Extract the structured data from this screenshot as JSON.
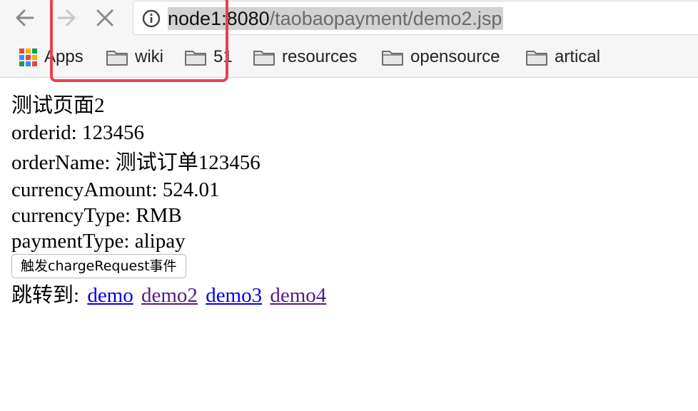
{
  "browser": {
    "url_host": "node1:8080",
    "url_path": "/taobaopayment/demo2.jsp",
    "bookmarks": {
      "apps": "Apps",
      "items": [
        "wiki",
        "51",
        "resources",
        "opensource",
        "artical"
      ]
    },
    "icons": [
      "back-arrow-icon",
      "forward-arrow-icon",
      "stop-icon",
      "info-icon",
      "apps-grid-icon",
      "folder-icon"
    ],
    "highlight_color": "#e8424f"
  },
  "page": {
    "title": "测试页面2",
    "orderid": "orderid: 123456",
    "orderName": "orderName: 测试订单123456",
    "currencyAmount": "currencyAmount: 524.01",
    "currencyType": "currencyType: RMB",
    "paymentType": "paymentType: alipay",
    "charge_button": "触发chargeRequest事件",
    "jump_label": "跳转到:",
    "links": [
      "demo",
      "demo2",
      "demo3",
      "demo4"
    ],
    "link_colors": {
      "unvisited": "#0000ee",
      "visited": "#551a8b"
    }
  }
}
